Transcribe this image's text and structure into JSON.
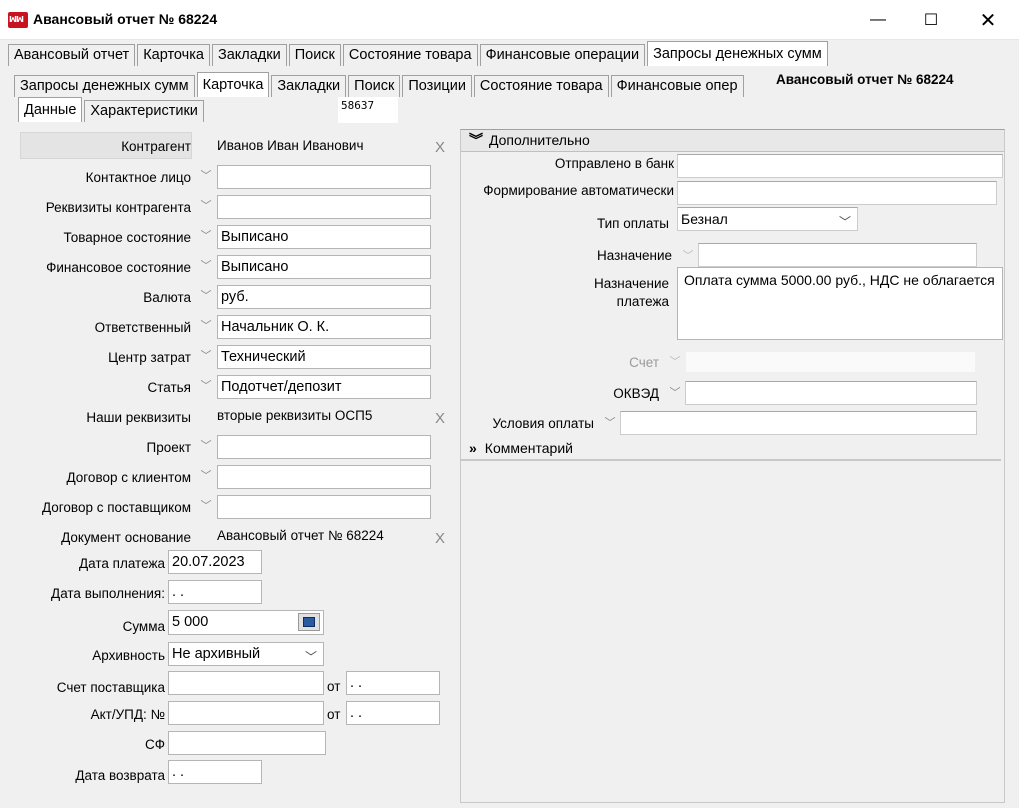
{
  "window": {
    "title": "Авансовый отчет № 68224",
    "minimize": "—",
    "maximize": "☐",
    "close": "✕"
  },
  "main_tabs": [
    "Авансовый отчет",
    "Карточка",
    "Закладки",
    "Поиск",
    "Состояние товара",
    "Финансовые операции",
    "Запросы денежных сумм"
  ],
  "sub_tabs": [
    "Запросы денежных сумм",
    "Карточка",
    "Закладки",
    "Поиск",
    "Позиции",
    "Состояние товара",
    "Финансовые опер"
  ],
  "data_tabs": [
    "Данные",
    "Характеристики"
  ],
  "doc_heading": "Авансовый отчет № 68224",
  "doc_number": "58637",
  "left": {
    "kontragent_label": "Контрагент",
    "kontragent_value": "Иванов Иван Иванович",
    "contact_label": "Контактное лицо",
    "contact_value": "",
    "requisites_label": "Реквизиты контрагента",
    "requisites_value": "",
    "goods_state_label": "Товарное состояние",
    "goods_state_value": "Выписано",
    "fin_state_label": "Финансовое состояние",
    "fin_state_value": "Выписано",
    "currency_label": "Валюта",
    "currency_value": "руб.",
    "responsible_label": "Ответственный",
    "responsible_value": "Начальник О. К.",
    "cost_center_label": "Центр затрат",
    "cost_center_value": "Технический",
    "article_label": "Статья",
    "article_value": "Подотчет/депозит",
    "our_req_label": "Наши реквизиты",
    "our_req_value": "вторые реквизиты ОСП5",
    "project_label": "Проект",
    "project_value": "",
    "client_contract_label": "Договор с клиентом",
    "client_contract_value": "",
    "supplier_contract_label": "Договор с поставщиком",
    "supplier_contract_value": "",
    "base_doc_label": "Документ основание",
    "base_doc_value": "Авансовый отчет № 68224",
    "pay_date_label": "Дата платежа",
    "pay_date_value": "20.07.2023",
    "exec_date_label": "Дата выполнения:",
    "exec_date_value": " .  .",
    "sum_label": "Сумма",
    "sum_value": "5 000",
    "archive_label": "Архивность",
    "archive_value": "Не архивный",
    "supplier_invoice_label": "Счет поставщика",
    "supplier_invoice_value": "",
    "from_label": "от",
    "supplier_invoice_date": " .  .",
    "act_label": "Акт/УПД: №",
    "act_value": "",
    "act_date": " .  .",
    "sf_label": "СФ",
    "sf_value": "",
    "return_date_label": "Дата возврата",
    "return_date_value": " .  ."
  },
  "right": {
    "additional_header": "Дополнительно",
    "sent_bank_label": "Отправлено в банк",
    "sent_bank_value": "",
    "auto_form_label": "Формирование автоматически",
    "auto_form_value": "",
    "payment_type_label": "Тип оплаты",
    "payment_type_value": "Безнал",
    "purpose_label": "Назначение",
    "purpose_value": "",
    "payment_purpose_label_1": "Назначение",
    "payment_purpose_label_2": "платежа",
    "payment_purpose_value": "Оплата сумма 5000.00 руб., НДС не облагается",
    "account_label": "Счет",
    "account_value": "",
    "okved_label": "ОКВЭД",
    "okved_value": "",
    "pay_terms_label": "Условия оплаты",
    "pay_terms_value": "",
    "comment_header": "Комментарий"
  }
}
